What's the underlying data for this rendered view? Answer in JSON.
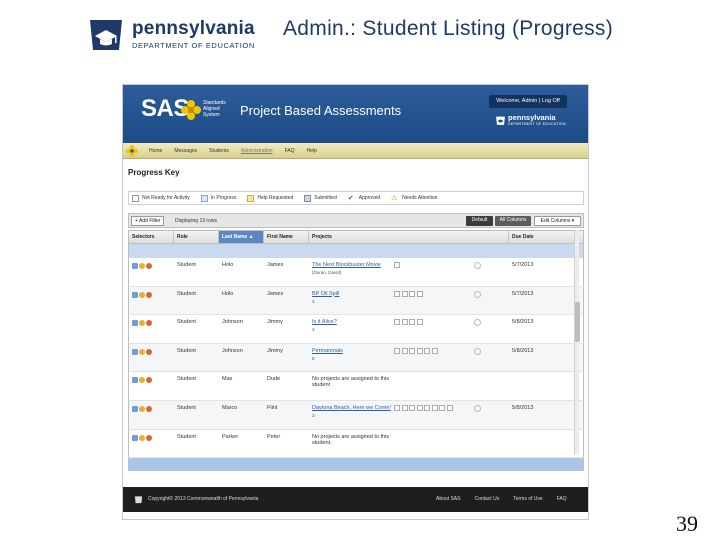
{
  "slide": {
    "logo_name": "pennsylvania",
    "logo_dept": "DEPARTMENT OF EDUCATION",
    "title": "Admin.:  Student Listing (Progress)",
    "page_number": "39"
  },
  "app": {
    "brand": "SAS",
    "brand_sub": "Standards Aligned System",
    "product_title": "Project Based Assessments",
    "welcome": "Welcome, Admin | Log Off",
    "mini_logo_name": "pennsylvania",
    "mini_logo_dept": "DEPARTMENT OF EDUCATION",
    "colors": {
      "banner": "#2c5d9a",
      "nav": "#e6dfa6",
      "selected": "#c9daf0",
      "footer": "#1e1e1e"
    }
  },
  "nav": {
    "items": [
      "Home",
      "Messages",
      "Students",
      "Administration",
      "FAQ",
      "Help"
    ],
    "active_index": 3
  },
  "progress_key": {
    "title": "Progress Key",
    "items": [
      "Not Ready for Activity",
      "In Progress",
      "Help Requested",
      "Submitted",
      "Approved",
      "Needs Attention"
    ]
  },
  "toolbar": {
    "add_filter": "+ Add Filter",
    "displaying": "Displaying 13 rows",
    "default_label": "Default",
    "all_columns_label": "All Columns",
    "edit_columns_label": "Edit Columns ▾"
  },
  "grid": {
    "headers": [
      "Selectors",
      "Role",
      "Last Name ▲",
      "First Name",
      "Projects",
      "Due Date"
    ],
    "rows": [
      {
        "role": "Student",
        "last": "Holo",
        "first": "James",
        "project": "The Next Blockbuster Movie",
        "project_sub": "(Duran, David)",
        "squares": 1,
        "due": "5/7/2013"
      },
      {
        "role": "Student",
        "last": "Holo",
        "first": "James",
        "project": "BP Oil Spill",
        "project_sub": "3",
        "squares": 4,
        "due": "5/7/2013"
      },
      {
        "role": "Student",
        "last": "Johnson",
        "first": "Jimmy",
        "project": "Is it Alive?",
        "project_sub": "3",
        "squares": 4,
        "due": "5/8/2013"
      },
      {
        "role": "Student",
        "last": "Johnson",
        "first": "Jimmy",
        "project": "Permanmals",
        "project_sub": "5",
        "squares": 6,
        "due": "5/8/2013"
      },
      {
        "role": "Student",
        "last": "Max",
        "first": "Dude",
        "project": "No projects are assigned to this student",
        "project_sub": "",
        "squares": 0,
        "due": ""
      },
      {
        "role": "Student",
        "last": "Marco",
        "first": "Flint",
        "project": "Daytona Beach, Here we Come!",
        "project_sub": "3",
        "squares": 8,
        "due": "5/8/2013"
      },
      {
        "role": "Student",
        "last": "Parker",
        "first": "Peter",
        "project": "No projects are assigned to this student.",
        "project_sub": "",
        "squares": 0,
        "due": ""
      }
    ]
  },
  "footer": {
    "copyright": "Copyright© 2013 Commonwealth of Pennsylvania",
    "links": [
      "About SAS",
      "Contact Us",
      "Terms of Use",
      "FAQ"
    ]
  }
}
